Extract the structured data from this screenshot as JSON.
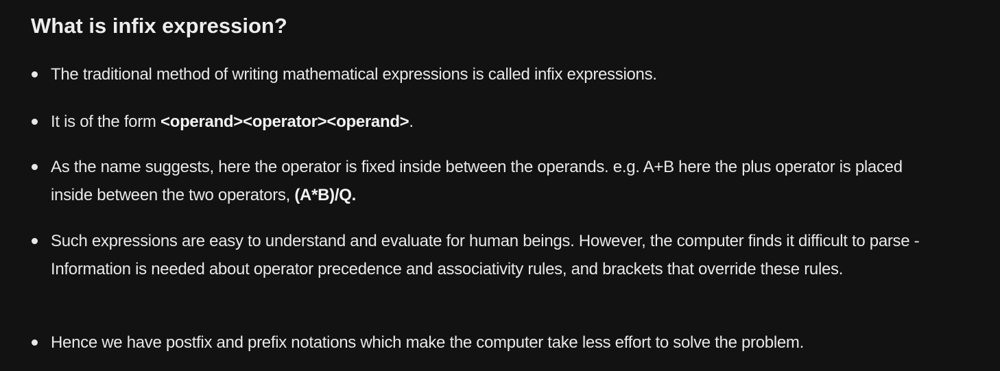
{
  "heading": "What is infix expression?",
  "items": [
    {
      "text": "The traditional method of writing mathematical expressions is called infix expressions."
    },
    {
      "before": "It is of the form ",
      "bold": "<operand><operator><operand>",
      "after": "."
    },
    {
      "before": "As the name suggests, here the operator is fixed inside between the operands. e.g. A+B here the plus operator is placed inside between the two operators, ",
      "bold": "(A*B)/Q."
    },
    {
      "text": "Such expressions are easy to understand and evaluate for human beings. However, the computer finds it difficult to parse - Information is needed about operator precedence and associativity rules, and brackets that override these rules."
    },
    {
      "text": "Hence we have postfix and prefix notations which make the computer take less effort to solve the problem."
    }
  ]
}
